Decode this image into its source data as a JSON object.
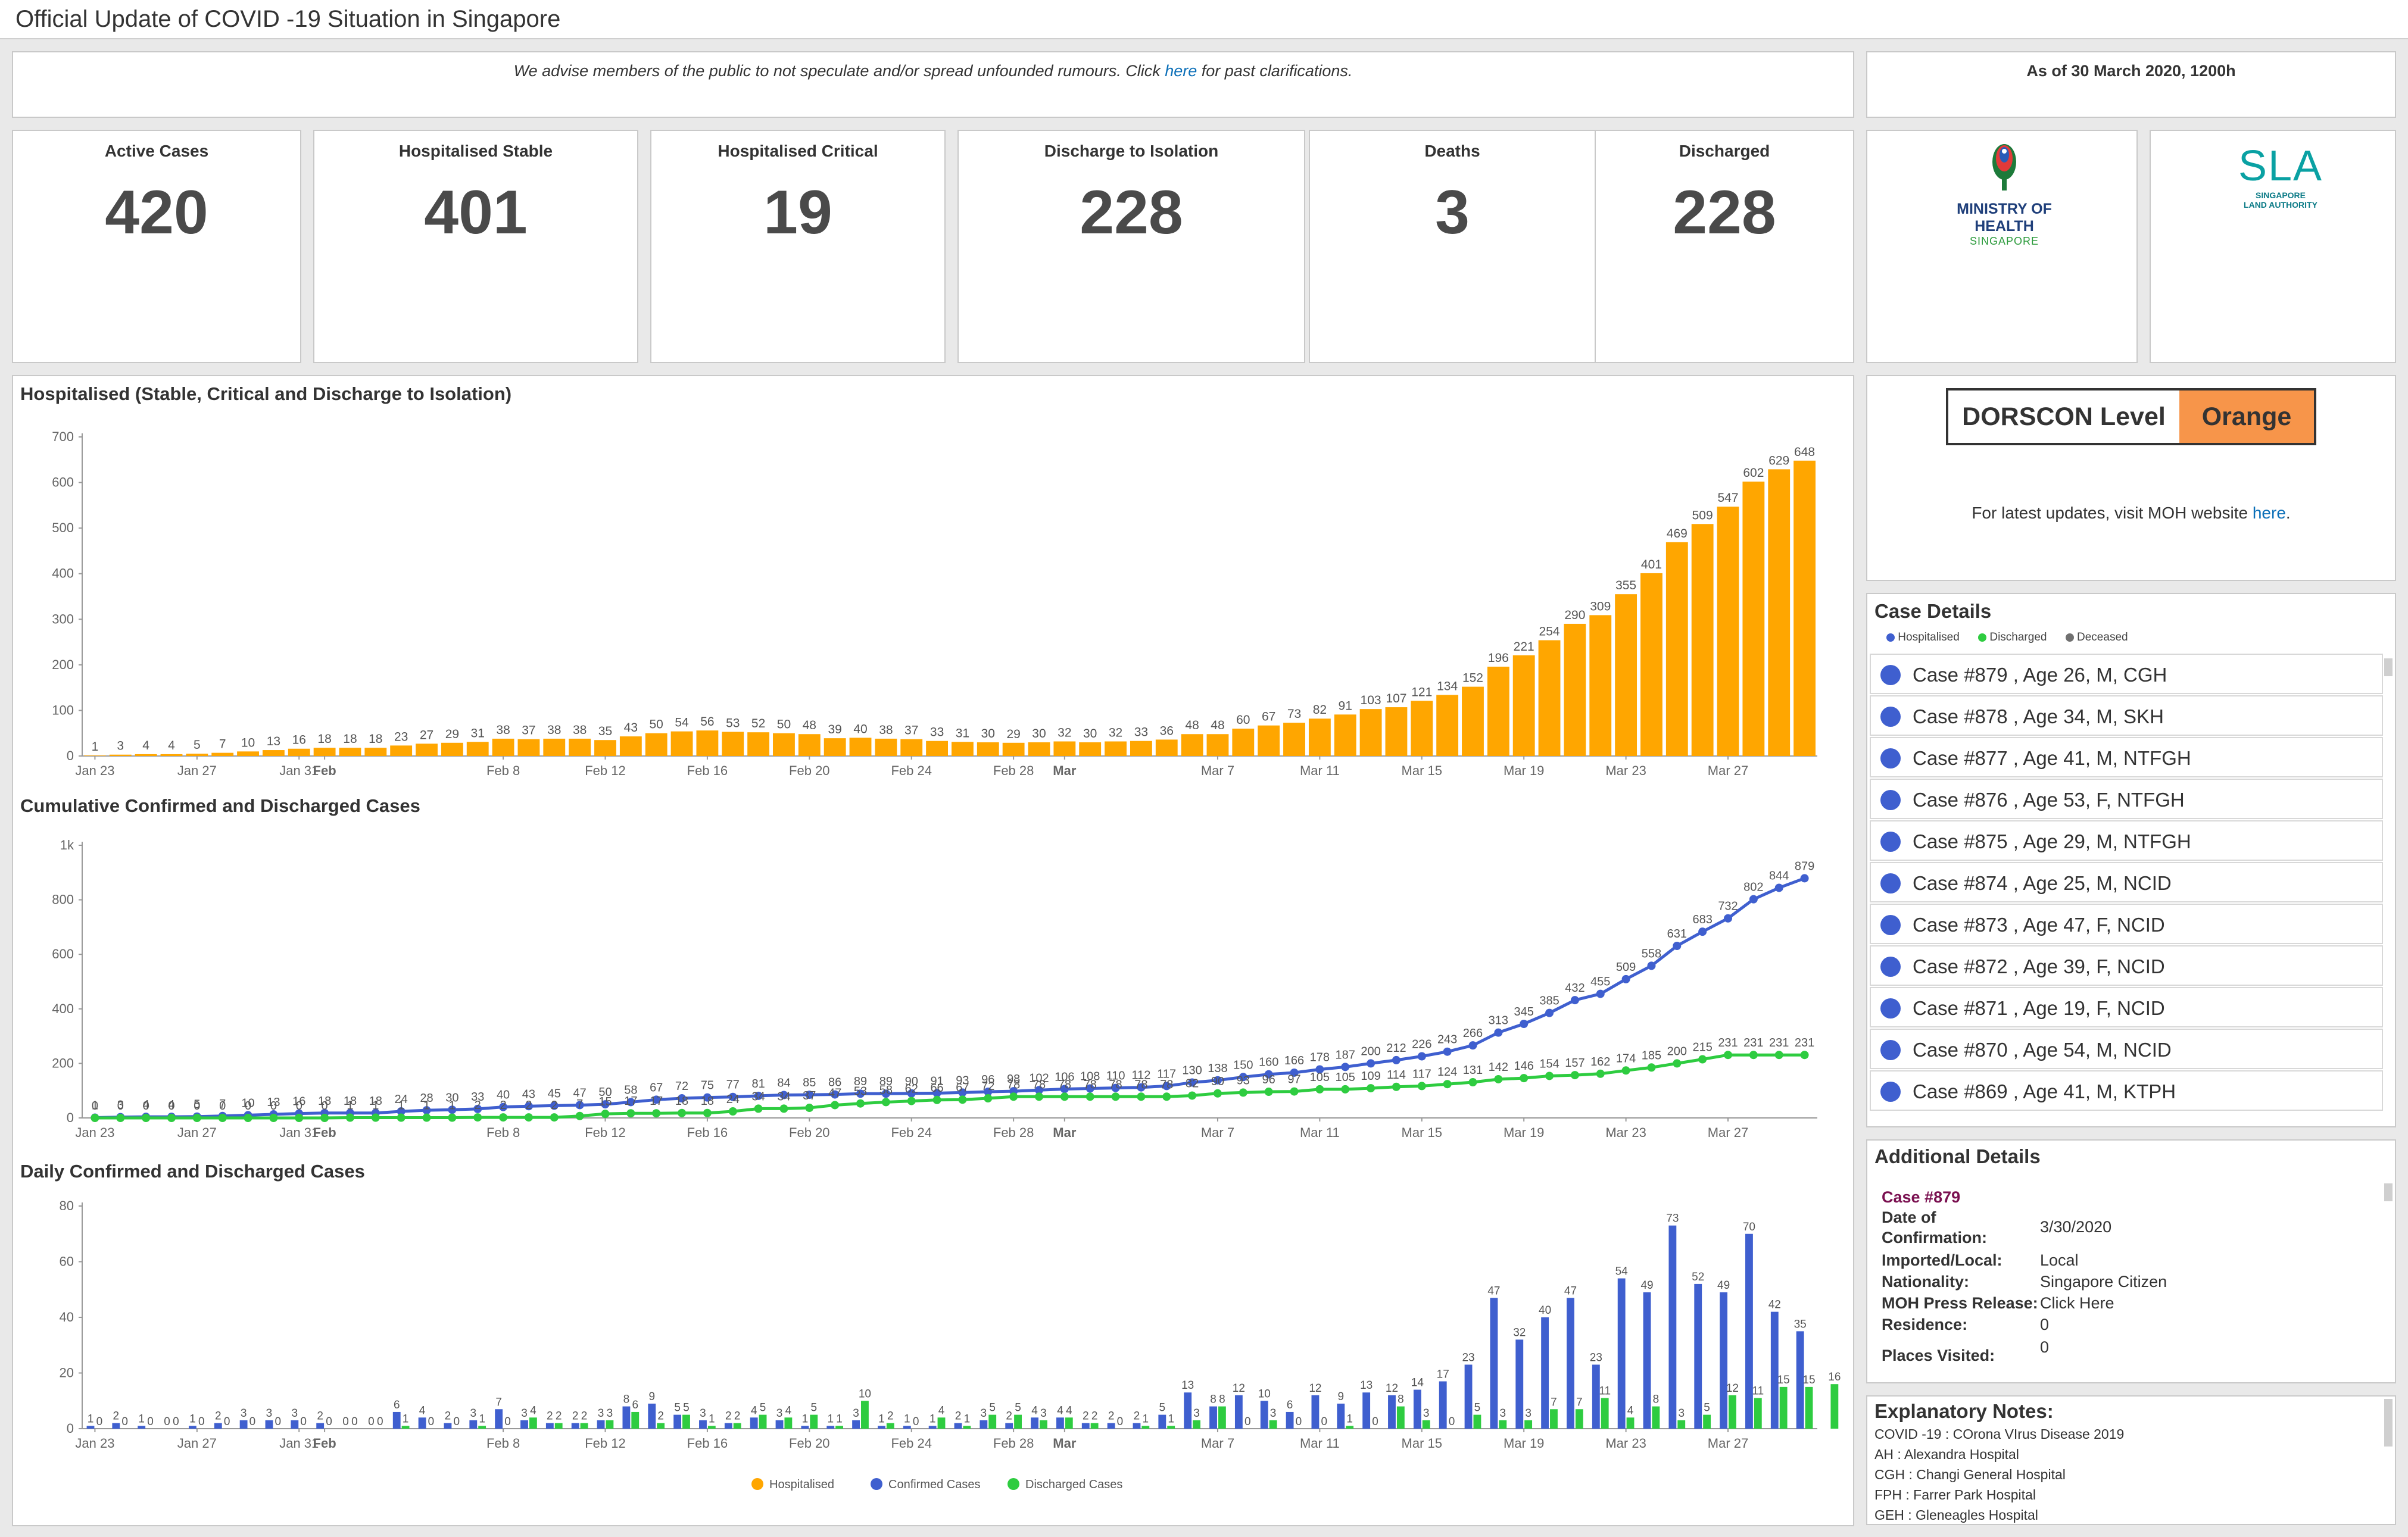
{
  "app": {
    "title": "Official Update of COVID -19 Situation in Singapore"
  },
  "notice": {
    "before": "We advise members of the public to not speculate and/or spread unfounded rumours.  Click ",
    "link": "here",
    "after": " for past clarifications."
  },
  "asof": "As of 30 March 2020, 1200h",
  "kpis": [
    {
      "label": "Active Cases",
      "value": "420"
    },
    {
      "label": "Hospitalised Stable",
      "value": "401"
    },
    {
      "label": "Hospitalised Critical",
      "value": "19"
    },
    {
      "label": "Discharge to Isolation",
      "value": "228"
    },
    {
      "label": "Deaths",
      "value": "3"
    },
    {
      "label": "Discharged",
      "value": "228"
    }
  ],
  "logos": {
    "moh_line1": "MINISTRY OF HEALTH",
    "moh_line2": "SINGAPORE",
    "sla_big": "SLA",
    "sla_line1": "SINGAPORE",
    "sla_line2": "LAND AUTHORITY"
  },
  "dorscon": {
    "label": "DORSCON Level",
    "value": "Orange",
    "updates_before": "For latest updates, visit MOH website ",
    "updates_link": "here",
    "updates_after": "."
  },
  "case_details": {
    "title": "Case Details",
    "legend": [
      "Hospitalised",
      "Discharged",
      "Deceased"
    ],
    "legend_colors": [
      "#3f5fcf",
      "#2ecc40",
      "#707070"
    ],
    "cases": [
      "Case #879 , Age 26, M, CGH",
      "Case #878 , Age 34, M, SKH",
      "Case #877 , Age 41, M, NTFGH",
      "Case #876 , Age 53, F, NTFGH",
      "Case #875 , Age 29, M, NTFGH",
      "Case #874 , Age 25, M, NCID",
      "Case #873 , Age 47, F, NCID",
      "Case #872 , Age 39, F, NCID",
      "Case #871 , Age 19, F, NCID",
      "Case #870 , Age 54, M, NCID",
      "Case #869 , Age 41, M, KTPH"
    ]
  },
  "additional": {
    "title": "Additional Details",
    "case": "Case #879",
    "fields": [
      {
        "label": "Date of",
        "value": ""
      },
      {
        "label": "Confirmation:",
        "value": "3/30/2020"
      },
      {
        "label": "Imported/Local:",
        "value": "Local"
      },
      {
        "label": "Nationality:",
        "value": "Singapore Citizen"
      },
      {
        "label": "MOH Press Release:",
        "value": "Click Here"
      },
      {
        "label": "Residence:",
        "value": "0"
      },
      {
        "label": "Places Visited:",
        "value": "0"
      }
    ]
  },
  "notes": {
    "title": "Explanatory Notes:",
    "items": [
      "COVID -19 : COrona VIrus Disease 2019",
      "AH : Alexandra Hospital",
      "CGH : Changi General Hospital",
      "FPH : Farrer Park Hospital",
      "GEH : Gleneagles Hospital"
    ]
  },
  "colors": {
    "hospitalised": "#ffa600",
    "confirmed": "#3f5fcf",
    "discharged": "#2ecc40"
  },
  "chart_data": [
    {
      "type": "bar",
      "title": "Hospitalised (Stable, Critical and Discharge to Isolation)",
      "ylim": [
        0,
        700
      ],
      "yticks": [
        0,
        100,
        200,
        300,
        400,
        500,
        600,
        700
      ],
      "x_start": "Jan 23",
      "x_tick_labels": [
        "Jan 23",
        "Jan 27",
        "Jan 31",
        "Feb",
        "Feb 8",
        "Feb 12",
        "Feb 16",
        "Feb 20",
        "Feb 24",
        "Feb 28",
        "Mar",
        "Mar 7",
        "Mar 11",
        "Mar 15",
        "Mar 19",
        "Mar 23",
        "Mar 27"
      ],
      "series": [
        {
          "values": [
            1,
            3,
            4,
            4,
            5,
            7,
            10,
            13,
            16,
            18,
            18,
            18,
            23,
            27,
            29,
            31,
            38,
            37,
            38,
            38,
            35,
            43,
            50,
            54,
            56,
            53,
            52,
            50,
            48,
            39,
            40,
            38,
            37,
            33,
            31,
            30,
            29,
            30,
            32,
            30,
            32,
            33,
            36,
            48,
            48,
            60,
            67,
            73,
            82,
            91,
            103,
            107,
            121,
            134,
            152,
            196,
            221,
            254,
            290,
            309,
            355,
            401,
            469,
            509,
            547,
            602,
            629,
            648
          ]
        }
      ]
    },
    {
      "type": "line",
      "title": "Cumulative Confirmed and Discharged Cases",
      "ylim": [
        0,
        1000
      ],
      "yticks": [
        0,
        200,
        400,
        600,
        800,
        1000
      ],
      "ytick_labels": [
        "0",
        "200",
        "400",
        "600",
        "800",
        "1k"
      ],
      "x_start": "Jan 23",
      "x_tick_labels": [
        "Jan 23",
        "Jan 27",
        "Jan 31",
        "Feb",
        "Feb 8",
        "Feb 12",
        "Feb 16",
        "Feb 20",
        "Feb 24",
        "Feb 28",
        "Mar",
        "Mar 7",
        "Mar 11",
        "Mar 15",
        "Mar 19",
        "Mar 23",
        "Mar 27"
      ],
      "series": [
        {
          "name": "Confirmed Cases",
          "values": [
            1,
            3,
            4,
            4,
            5,
            7,
            10,
            13,
            16,
            18,
            18,
            18,
            24,
            28,
            30,
            33,
            40,
            43,
            45,
            47,
            50,
            58,
            67,
            72,
            75,
            77,
            81,
            84,
            85,
            86,
            89,
            89,
            90,
            91,
            93,
            96,
            98,
            102,
            106,
            108,
            110,
            112,
            117,
            130,
            138,
            150,
            160,
            166,
            178,
            187,
            200,
            212,
            226,
            243,
            266,
            313,
            345,
            385,
            432,
            455,
            509,
            558,
            631,
            683,
            732,
            802,
            844,
            879
          ]
        },
        {
          "name": "Discharged Cases",
          "values": [
            0,
            0,
            0,
            0,
            0,
            0,
            0,
            0,
            0,
            0,
            1,
            1,
            1,
            1,
            1,
            2,
            2,
            2,
            2,
            7,
            15,
            17,
            17,
            18,
            18,
            24,
            34,
            34,
            37,
            47,
            53,
            58,
            62,
            66,
            67,
            72,
            78,
            78,
            78,
            78,
            78,
            78,
            78,
            82,
            90,
            93,
            96,
            97,
            105,
            105,
            109,
            114,
            117,
            124,
            131,
            142,
            146,
            154,
            157,
            162,
            174,
            185,
            200,
            215,
            231,
            231,
            231,
            231
          ]
        }
      ]
    },
    {
      "type": "bar",
      "title": "Daily Confirmed and Discharged Cases",
      "ylim": [
        0,
        80
      ],
      "yticks": [
        0,
        20,
        40,
        60,
        80
      ],
      "x_start": "Jan 23",
      "x_tick_labels": [
        "Jan 23",
        "Jan 27",
        "Jan 31",
        "Feb",
        "Feb 8",
        "Feb 12",
        "Feb 16",
        "Feb 20",
        "Feb 24",
        "Feb 28",
        "Mar",
        "Mar 7",
        "Mar 11",
        "Mar 15",
        "Mar 19",
        "Mar 23",
        "Mar 27"
      ],
      "legend": [
        "Hospitalised",
        "Confirmed Cases",
        "Discharged Cases"
      ],
      "series": [
        {
          "name": "Confirmed Cases",
          "values": [
            1,
            2,
            1,
            0,
            1,
            2,
            3,
            3,
            3,
            2,
            0,
            0,
            6,
            4,
            2,
            3,
            7,
            3,
            2,
            2,
            3,
            8,
            9,
            5,
            3,
            2,
            4,
            3,
            1,
            1,
            3,
            1,
            1,
            1,
            2,
            3,
            2,
            4,
            4,
            2,
            2,
            2,
            5,
            13,
            8,
            12,
            10,
            6,
            12,
            9,
            13,
            12,
            14,
            17,
            23,
            47,
            32,
            40,
            47,
            23,
            54,
            49,
            73,
            52,
            49,
            70,
            42,
            35
          ]
        },
        {
          "name": "Discharged Cases",
          "values": [
            0,
            0,
            0,
            0,
            0,
            0,
            0,
            0,
            0,
            0,
            0,
            0,
            1,
            0,
            0,
            1,
            0,
            4,
            2,
            2,
            3,
            6,
            2,
            5,
            1,
            2,
            5,
            4,
            5,
            1,
            10,
            2,
            0,
            4,
            1,
            5,
            5,
            3,
            4,
            2,
            0,
            1,
            1,
            3,
            8,
            0,
            3,
            0,
            0,
            1,
            0,
            8,
            3,
            0,
            5,
            3,
            3,
            7,
            7,
            11,
            4,
            8,
            3,
            5,
            12,
            11,
            15,
            15,
            16
          ]
        }
      ]
    }
  ]
}
